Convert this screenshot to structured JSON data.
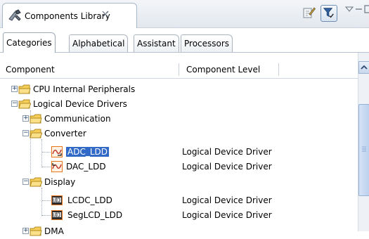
{
  "view": {
    "title": "Components Library",
    "close_icon": "close-icon",
    "toolbar": {
      "edit_icon": "edit-icon",
      "filter_icon": "filter-icon",
      "menu_icon": "view-menu-icon",
      "minimize_icon": "minimize-icon",
      "maximize_icon": "maximize-icon"
    }
  },
  "tabs": [
    {
      "label": "Categories",
      "active": true
    },
    {
      "label": "Alphabetical",
      "active": false
    },
    {
      "label": "Assistant",
      "active": false
    },
    {
      "label": "Processors",
      "active": false
    }
  ],
  "columns": {
    "component": "Component",
    "level": "Component Level"
  },
  "tree": [
    {
      "label": "CPU Internal Peripherals",
      "level": "",
      "depth": 0,
      "kind": "folder",
      "expanded": false
    },
    {
      "label": "Logical Device Drivers",
      "level": "",
      "depth": 0,
      "kind": "folder",
      "expanded": true
    },
    {
      "label": "Communication",
      "level": "",
      "depth": 1,
      "kind": "folder",
      "expanded": false
    },
    {
      "label": "Converter",
      "level": "",
      "depth": 1,
      "kind": "folder",
      "expanded": true
    },
    {
      "label": "ADC_LDD",
      "level": "Logical Device Driver",
      "depth": 2,
      "kind": "adc",
      "selected": true
    },
    {
      "label": "DAC_LDD",
      "level": "Logical Device Driver",
      "depth": 2,
      "kind": "dac"
    },
    {
      "label": "Display",
      "level": "",
      "depth": 1,
      "kind": "folder",
      "expanded": true
    },
    {
      "label": "LCDC_LDD",
      "level": "Logical Device Driver",
      "depth": 2,
      "kind": "lcd"
    },
    {
      "label": "SegLCD_LDD",
      "level": "Logical Device Driver",
      "depth": 2,
      "kind": "lcd"
    },
    {
      "label": "DMA",
      "level": "",
      "depth": 1,
      "kind": "folder",
      "expanded": false
    }
  ],
  "colors": {
    "selection": "#3169c6",
    "folder": "#f5c84a",
    "accent": "#e8741a"
  }
}
